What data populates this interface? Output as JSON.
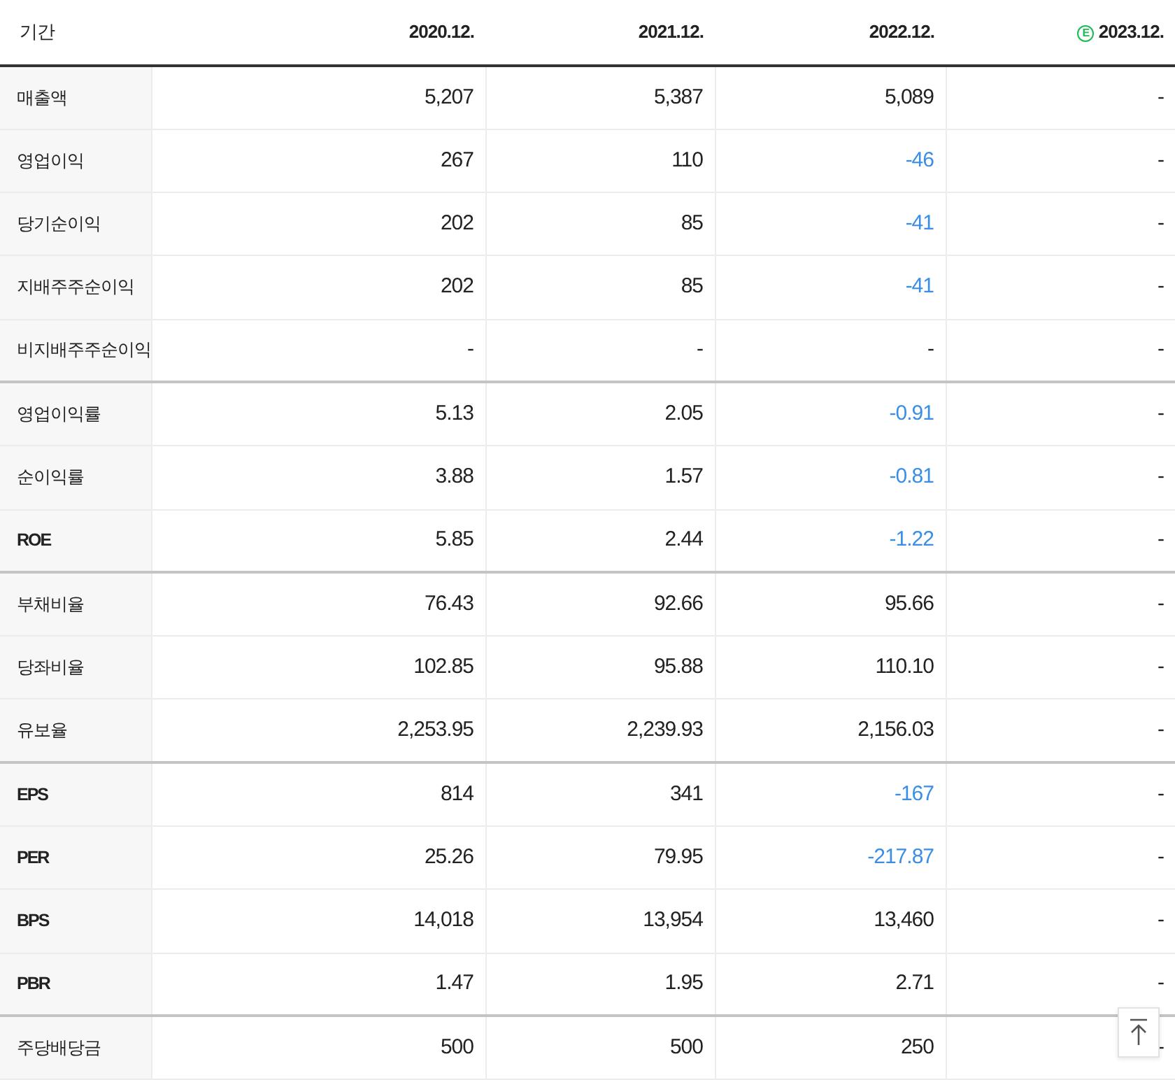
{
  "columns": [
    {
      "label": "기간"
    },
    {
      "label": "2020.12."
    },
    {
      "label": "2021.12."
    },
    {
      "label": "2022.12."
    },
    {
      "label": "2023.12.",
      "estimate_mark": "E"
    }
  ],
  "rows": [
    {
      "label": "매출액",
      "group_start": false,
      "bold": false,
      "values": [
        {
          "text": "5,207",
          "negative": false
        },
        {
          "text": "5,387",
          "negative": false
        },
        {
          "text": "5,089",
          "negative": false
        },
        {
          "text": "-",
          "negative": false
        }
      ]
    },
    {
      "label": "영업이익",
      "group_start": false,
      "bold": false,
      "values": [
        {
          "text": "267",
          "negative": false
        },
        {
          "text": "110",
          "negative": false
        },
        {
          "text": "-46",
          "negative": true
        },
        {
          "text": "-",
          "negative": false
        }
      ]
    },
    {
      "label": "당기순이익",
      "group_start": false,
      "bold": false,
      "values": [
        {
          "text": "202",
          "negative": false
        },
        {
          "text": "85",
          "negative": false
        },
        {
          "text": "-41",
          "negative": true
        },
        {
          "text": "-",
          "negative": false
        }
      ]
    },
    {
      "label": "지배주주순이익",
      "group_start": false,
      "bold": false,
      "values": [
        {
          "text": "202",
          "negative": false
        },
        {
          "text": "85",
          "negative": false
        },
        {
          "text": "-41",
          "negative": true
        },
        {
          "text": "-",
          "negative": false
        }
      ]
    },
    {
      "label": "비지배주주순이익",
      "group_start": false,
      "bold": false,
      "values": [
        {
          "text": "-",
          "negative": false
        },
        {
          "text": "-",
          "negative": false
        },
        {
          "text": "-",
          "negative": false
        },
        {
          "text": "-",
          "negative": false
        }
      ]
    },
    {
      "label": "영업이익률",
      "group_start": true,
      "bold": false,
      "values": [
        {
          "text": "5.13",
          "negative": false
        },
        {
          "text": "2.05",
          "negative": false
        },
        {
          "text": "-0.91",
          "negative": true
        },
        {
          "text": "-",
          "negative": false
        }
      ]
    },
    {
      "label": "순이익률",
      "group_start": false,
      "bold": false,
      "values": [
        {
          "text": "3.88",
          "negative": false
        },
        {
          "text": "1.57",
          "negative": false
        },
        {
          "text": "-0.81",
          "negative": true
        },
        {
          "text": "-",
          "negative": false
        }
      ]
    },
    {
      "label": "ROE",
      "group_start": false,
      "bold": true,
      "values": [
        {
          "text": "5.85",
          "negative": false
        },
        {
          "text": "2.44",
          "negative": false
        },
        {
          "text": "-1.22",
          "negative": true
        },
        {
          "text": "-",
          "negative": false
        }
      ]
    },
    {
      "label": "부채비율",
      "group_start": true,
      "bold": false,
      "values": [
        {
          "text": "76.43",
          "negative": false
        },
        {
          "text": "92.66",
          "negative": false
        },
        {
          "text": "95.66",
          "negative": false
        },
        {
          "text": "-",
          "negative": false
        }
      ]
    },
    {
      "label": "당좌비율",
      "group_start": false,
      "bold": false,
      "values": [
        {
          "text": "102.85",
          "negative": false
        },
        {
          "text": "95.88",
          "negative": false
        },
        {
          "text": "110.10",
          "negative": false
        },
        {
          "text": "-",
          "negative": false
        }
      ]
    },
    {
      "label": "유보율",
      "group_start": false,
      "bold": false,
      "values": [
        {
          "text": "2,253.95",
          "negative": false
        },
        {
          "text": "2,239.93",
          "negative": false
        },
        {
          "text": "2,156.03",
          "negative": false
        },
        {
          "text": "-",
          "negative": false
        }
      ]
    },
    {
      "label": "EPS",
      "group_start": true,
      "bold": true,
      "values": [
        {
          "text": "814",
          "negative": false
        },
        {
          "text": "341",
          "negative": false
        },
        {
          "text": "-167",
          "negative": true
        },
        {
          "text": "-",
          "negative": false
        }
      ]
    },
    {
      "label": "PER",
      "group_start": false,
      "bold": true,
      "values": [
        {
          "text": "25.26",
          "negative": false
        },
        {
          "text": "79.95",
          "negative": false
        },
        {
          "text": "-217.87",
          "negative": true
        },
        {
          "text": "-",
          "negative": false
        }
      ]
    },
    {
      "label": "BPS",
      "group_start": false,
      "bold": true,
      "values": [
        {
          "text": "14,018",
          "negative": false
        },
        {
          "text": "13,954",
          "negative": false
        },
        {
          "text": "13,460",
          "negative": false
        },
        {
          "text": "-",
          "negative": false
        }
      ]
    },
    {
      "label": "PBR",
      "group_start": false,
      "bold": true,
      "values": [
        {
          "text": "1.47",
          "negative": false
        },
        {
          "text": "1.95",
          "negative": false
        },
        {
          "text": "2.71",
          "negative": false
        },
        {
          "text": "-",
          "negative": false
        }
      ]
    },
    {
      "label": "주당배당금",
      "group_start": true,
      "bold": false,
      "values": [
        {
          "text": "500",
          "negative": false
        },
        {
          "text": "500",
          "negative": false
        },
        {
          "text": "250",
          "negative": false
        },
        {
          "text": "-",
          "negative": false
        }
      ]
    }
  ]
}
